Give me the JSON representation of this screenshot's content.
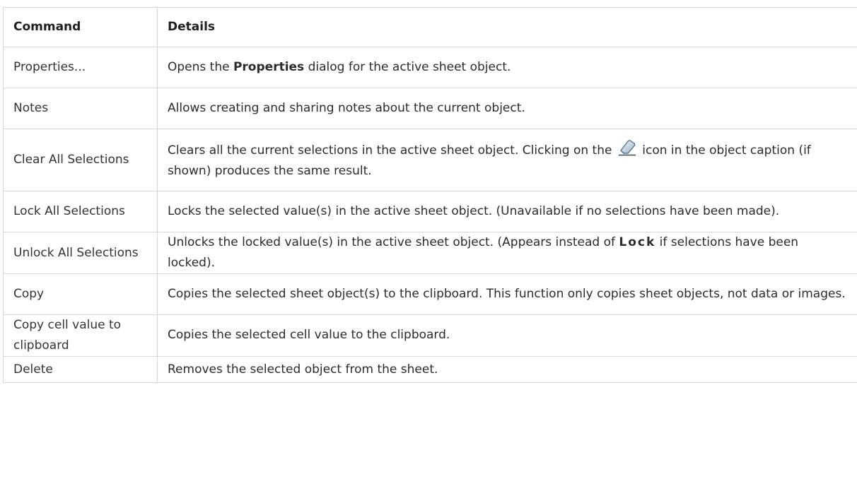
{
  "header": {
    "command_label": "Command",
    "details_label": "Details"
  },
  "rows": [
    {
      "command": "Properties...",
      "details_pre": "Opens the ",
      "details_bold": "Properties",
      "details_post": " dialog for the active sheet object."
    },
    {
      "command": "Notes",
      "details": "Allows creating and sharing notes about the current object."
    },
    {
      "command": "Clear All Selections",
      "details_pre": "Clears all the current selections in the active sheet object. Clicking on the ",
      "icon": "eraser-icon",
      "details_post": " icon in the object caption (if shown) produces the same result."
    },
    {
      "command": "Lock All Selections",
      "details": "Locks the selected value(s) in the active sheet object. (Unavailable if no selections have been made)."
    },
    {
      "command": "Unlock All Selections",
      "details_pre": "Unlocks the locked value(s) in the active sheet object. (Appears instead of ",
      "details_bold": "Lock",
      "details_post": " if selections have been locked)."
    },
    {
      "command": "Copy",
      "details": "Copies the selected sheet object(s) to the clipboard. This function only copies sheet objects, not data or images."
    },
    {
      "command": "Copy cell value to clipboard",
      "details": "Copies the selected cell value to the clipboard."
    },
    {
      "command": "Delete",
      "details": "Removes the selected object from the sheet."
    }
  ]
}
